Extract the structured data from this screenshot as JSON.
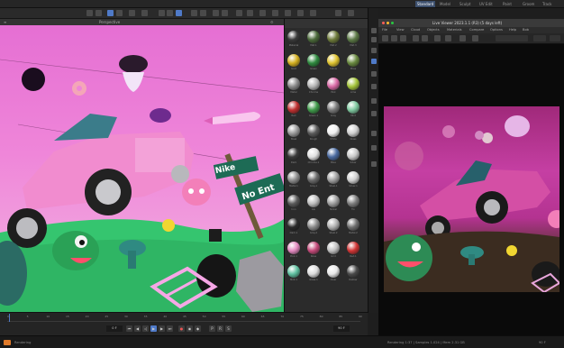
{
  "top_tabs": [
    "Standard",
    "Model",
    "Sculpt",
    "UV Edit",
    "Paint",
    "Groom",
    "Track"
  ],
  "active_tab_index": 0,
  "viewport": {
    "title": "Perspective",
    "sign_top": "Nike",
    "sign_bottom": "No Ent"
  },
  "material_browser": {
    "labels": [
      "Material",
      "Mat.1",
      "Mat.2",
      "Mat.3",
      "Gold",
      "Green",
      "Yellow",
      "Moss",
      "Metal",
      "Chrome",
      "Pink",
      "Lime",
      "Red",
      "Green.1",
      "Gray",
      "Mint",
      "Steel",
      "Rough",
      "White",
      "Glass",
      "Dark",
      "Chrome.1",
      "Blue",
      "Silver",
      "Metal.1",
      "Gray.1",
      "Steel.1",
      "Silver.1",
      "Iron",
      "Alu",
      "Nickel",
      "Tin",
      "Dark.1",
      "Gray.2",
      "Steel.2",
      "Metal.2",
      "Pink.1",
      "Rose",
      "Grid",
      "Red.1",
      "Mint.1",
      "Glass.1",
      "Clear",
      "Rubber"
    ]
  },
  "live_viewer": {
    "title": "Live Viewer 2023.1.1 (R3) (5 days left)",
    "menu": [
      "File",
      "View",
      "Cloud",
      "Objects",
      "Materials",
      "Compare",
      "Options",
      "Help",
      "Bob"
    ],
    "status": "Rendering"
  },
  "timeline": {
    "current_frame": "0 F",
    "frame_marks": [
      "0",
      "5",
      "10",
      "15",
      "20",
      "25",
      "30",
      "35",
      "40",
      "45",
      "50",
      "55",
      "60",
      "65",
      "70",
      "75",
      "80",
      "85",
      "90"
    ],
    "end_frame": "90 F"
  },
  "statusbar": {
    "left_text": "Rendering 1:37 | Samples 1.024 | Mem 2.31 GB",
    "right_text": "90 F"
  },
  "colors": {
    "accent": "#4f7ac8",
    "viewport_sky": "#e56fd3",
    "grass": "#35c56f",
    "render_bg": "#a0297a"
  }
}
